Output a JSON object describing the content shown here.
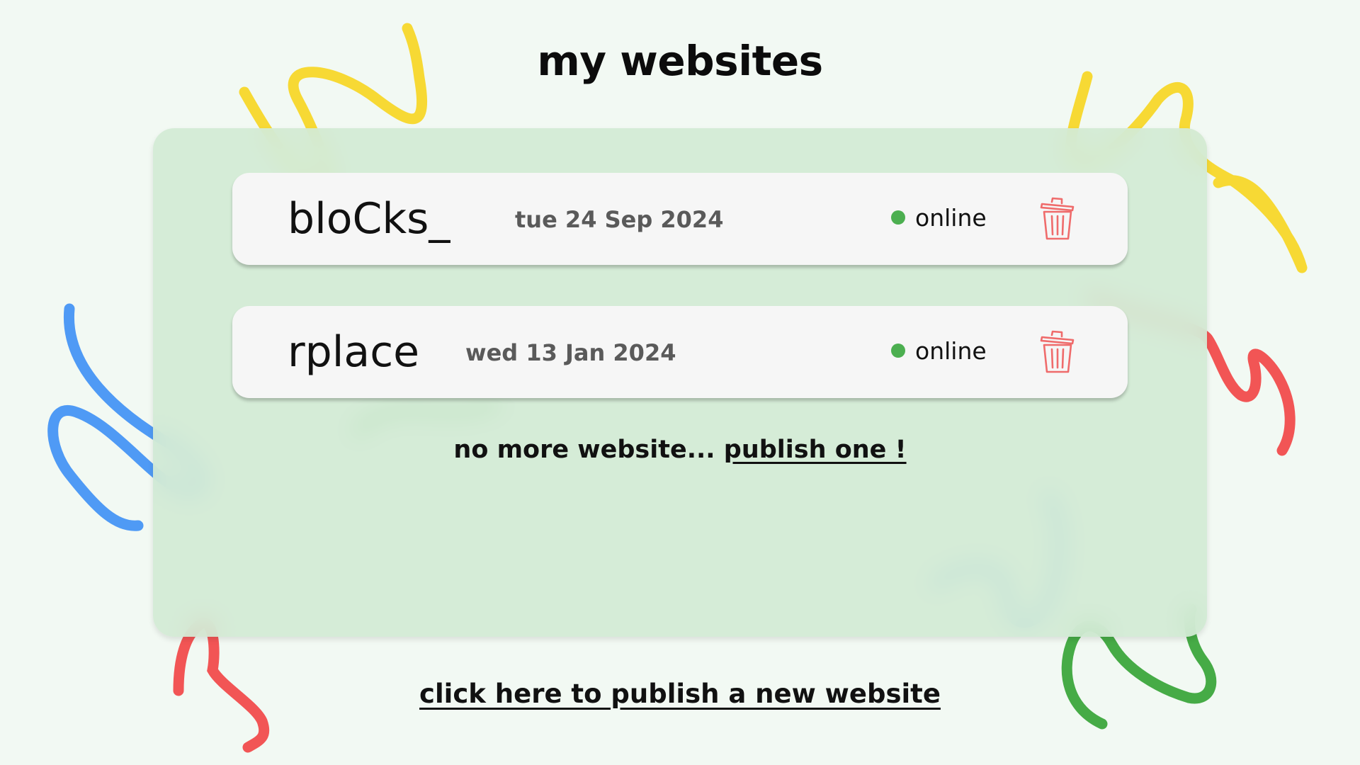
{
  "page": {
    "title": "my websites"
  },
  "websites": [
    {
      "name": "bloCks_",
      "date": "tue 24 Sep 2024",
      "status": "online"
    },
    {
      "name": "rplace",
      "date": "wed 13 Jan 2024",
      "status": "online"
    }
  ],
  "empty_note": {
    "text": "no more website... ",
    "link": "publish one !"
  },
  "footer": {
    "publish_link": "click here to publish a new website"
  },
  "colors": {
    "background": "#f2f9f3",
    "panel": "#d2ead4",
    "online": "#4caf50",
    "trash": "#ef6b6b",
    "squiggle_yellow": "#f7d934",
    "squiggle_blue": "#4f9af5",
    "squiggle_red": "#f25555",
    "squiggle_green": "#46ab46"
  },
  "icons": {
    "status": "status-dot-icon",
    "delete": "trash-icon"
  }
}
